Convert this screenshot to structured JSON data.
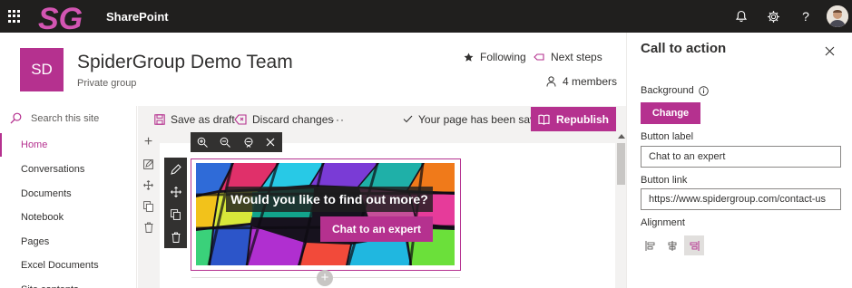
{
  "suitebar": {
    "app_name": "SharePoint",
    "logo_text": "SG",
    "icons": [
      "waffle-icon",
      "bell-icon",
      "gear-icon",
      "help-icon",
      "avatar"
    ]
  },
  "site": {
    "logo_initials": "SD",
    "title": "SpiderGroup Demo Team",
    "subtitle": "Private group",
    "following_label": "Following",
    "next_steps_label": "Next steps",
    "members_label": "4 members"
  },
  "search": {
    "placeholder": "Search this site"
  },
  "nav": {
    "items": [
      {
        "label": "Home",
        "active": true
      },
      {
        "label": "Conversations"
      },
      {
        "label": "Documents"
      },
      {
        "label": "Notebook"
      },
      {
        "label": "Pages"
      },
      {
        "label": "Excel Documents"
      },
      {
        "label": "Site contents"
      }
    ]
  },
  "commands": {
    "save_draft": "Save as draft",
    "discard": "Discard changes",
    "more": "···",
    "status": "Your page has been saved",
    "republish": "Republish"
  },
  "webpart": {
    "heading": "Would you like to find out more?",
    "button_label": "Chat to an expert"
  },
  "pane": {
    "title": "Call to action",
    "background_label": "Background",
    "change_label": "Change",
    "button_label_label": "Button label",
    "button_label_value": "Chat to an expert",
    "button_link_label": "Button link",
    "button_link_value": "https://www.spidergroup.com/contact-us",
    "alignment_label": "Alignment",
    "alignment_selected": "right"
  },
  "colors": {
    "accent": "#b5318f",
    "suitebar": "#201f1e",
    "toolbar_dark": "#323130",
    "command_bar": "#f3f2f1"
  }
}
